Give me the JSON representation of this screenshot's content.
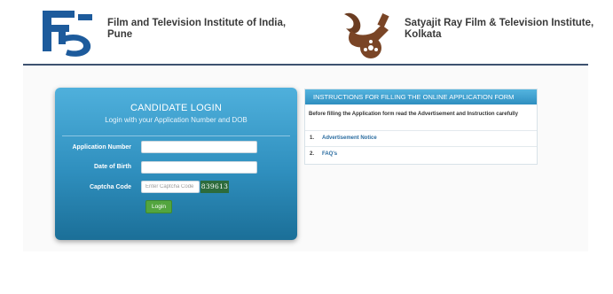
{
  "header": {
    "institute1_line1": "Film and Television Institute of India,",
    "institute1_line2": "Pune",
    "institute2_line1": "Satyajit Ray Film & Television Institute,",
    "institute2_line2": "Kolkata",
    "ftii_logo_icon": "ftii-logo-icon",
    "srfti_logo_icon": "srfti-film-reel-logo-icon",
    "rule_color": "#3d5270"
  },
  "login": {
    "title": "CANDIDATE LOGIN",
    "subtitle": "Login with your Application Number and DOB",
    "application_number_label": "Application Number",
    "application_number_value": "",
    "dob_label": "Date of Birth",
    "dob_value": "",
    "captcha_label": "Captcha Code",
    "captcha_placeholder": "Enter Captcha Code",
    "captcha_code": "839613",
    "login_button": "Login",
    "panel_color": "#2f8fbe",
    "button_color": "#53a53f"
  },
  "instructions": {
    "header": "INSTRUCTIONS FOR FILLING THE ONLINE APPLICATION FORM",
    "intro": "Before filling the Application form read the Advertisement and Instruction carefully",
    "items": [
      {
        "num": "1.",
        "label": "Advertisement Notice"
      },
      {
        "num": "2.",
        "label": "FAQ's"
      }
    ]
  }
}
